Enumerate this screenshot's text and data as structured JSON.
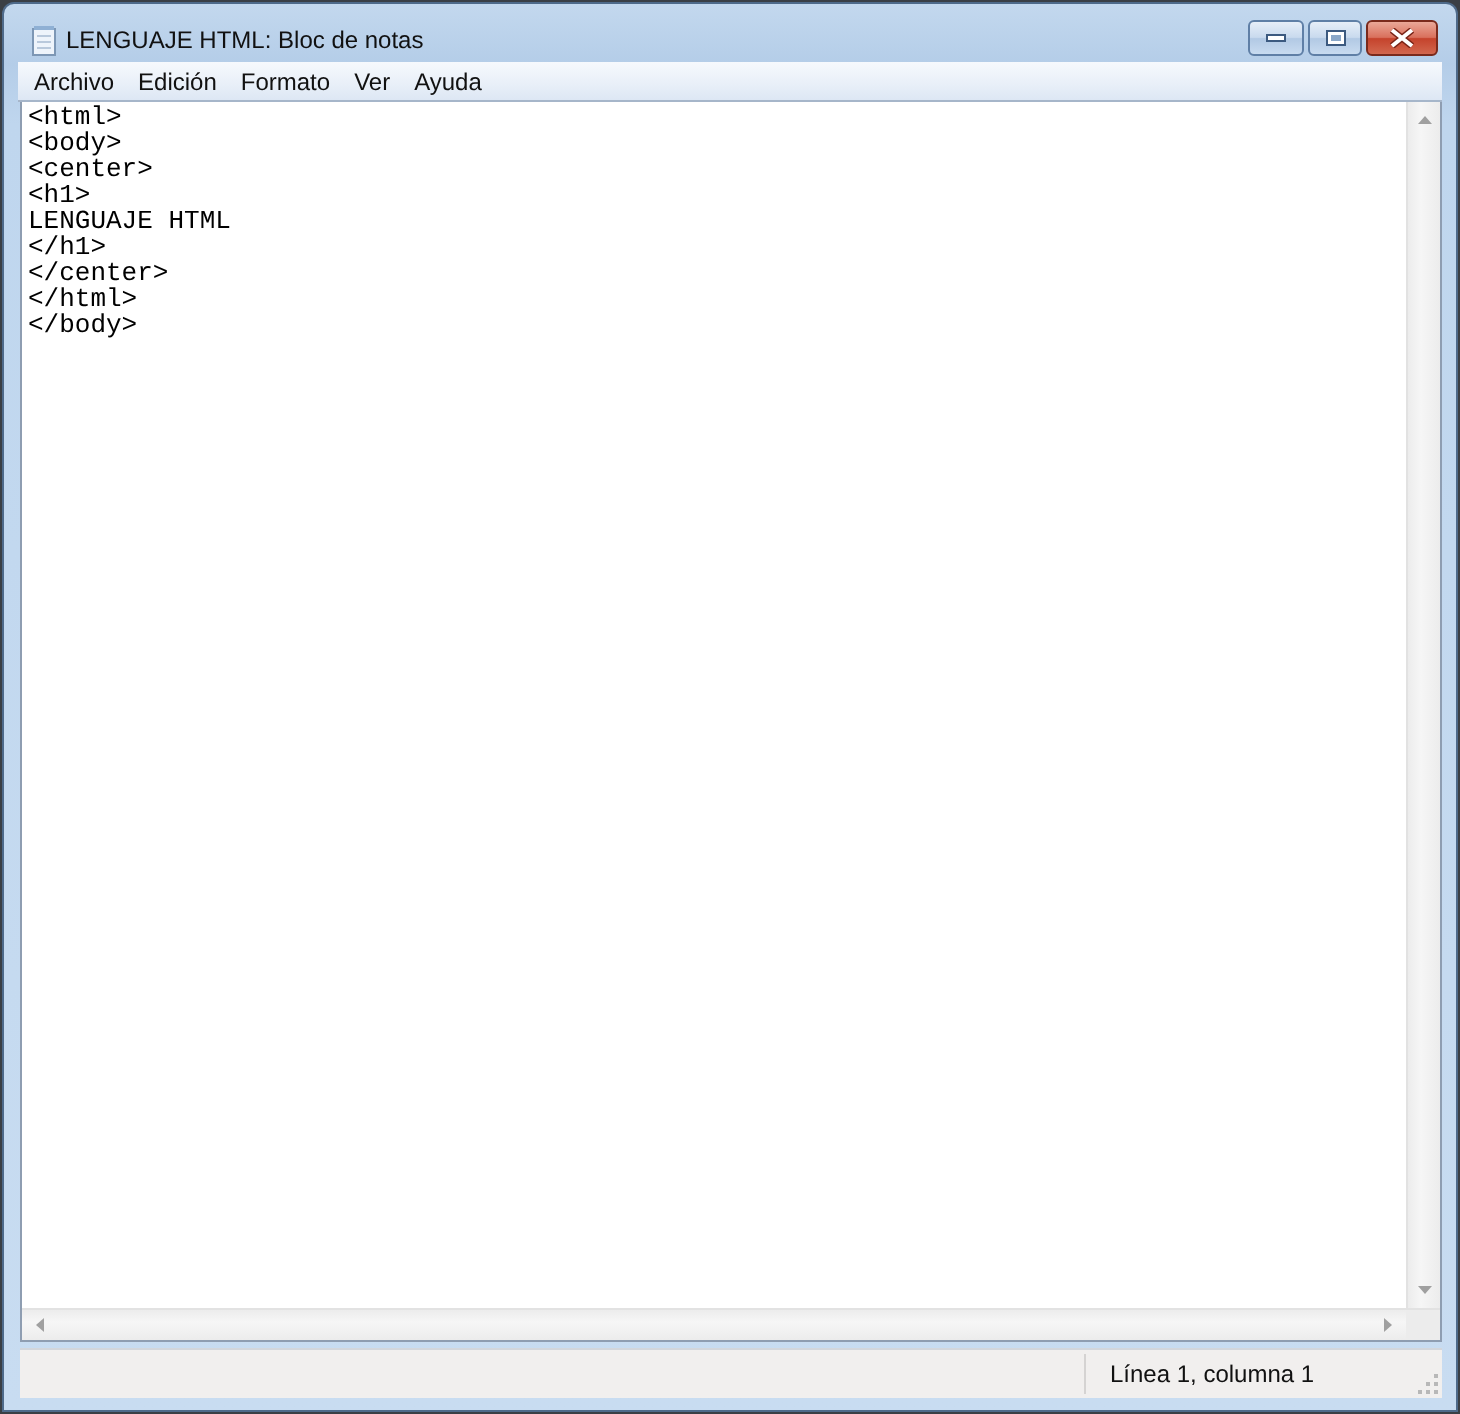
{
  "window": {
    "title": "LENGUAJE HTML: Bloc de notas"
  },
  "menu": [
    {
      "label": "Archivo"
    },
    {
      "label": "Edición"
    },
    {
      "label": "Formato"
    },
    {
      "label": "Ver"
    },
    {
      "label": "Ayuda"
    }
  ],
  "editor": {
    "lines": [
      "<html>",
      "<body>",
      "<center>",
      "<h1>",
      "LENGUAJE HTML",
      "</h1>",
      "</center>",
      "</html>",
      "</body>"
    ]
  },
  "status_bar": {
    "position": "Línea 1, columna 1"
  }
}
